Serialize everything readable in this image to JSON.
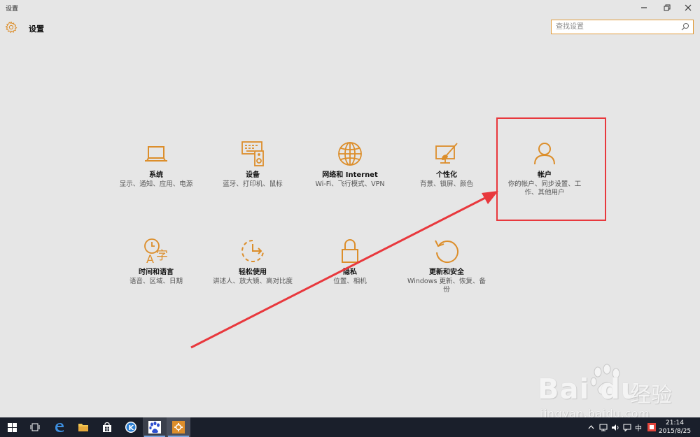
{
  "window": {
    "title": "设置",
    "controls": [
      "minimize-icon",
      "restore-icon",
      "close-icon"
    ]
  },
  "header": {
    "icon": "gear-icon",
    "title": "设置"
  },
  "search": {
    "placeholder": "查找设置",
    "value": "",
    "icon": "search-icon"
  },
  "tiles": [
    {
      "id": "system",
      "icon": "laptop-icon",
      "name": "系统",
      "desc": "显示、通知、应用、电源"
    },
    {
      "id": "devices",
      "icon": "devices-icon",
      "name": "设备",
      "desc": "蓝牙、打印机、鼠标"
    },
    {
      "id": "network",
      "icon": "globe-icon",
      "name": "网络和 Internet",
      "desc": "Wi-Fi、飞行模式、VPN"
    },
    {
      "id": "personalization",
      "icon": "paintbrush-icon",
      "name": "个性化",
      "desc": "背景、锁屏、颜色"
    },
    {
      "id": "accounts",
      "icon": "person-icon",
      "name": "帐户",
      "desc": "你的帐户、同步设置、工作、其他用户"
    },
    {
      "id": "time-language",
      "icon": "time-language-icon",
      "name": "时间和语言",
      "desc": "语音、区域、日期"
    },
    {
      "id": "ease-of-access",
      "icon": "ease-of-access-icon",
      "name": "轻松使用",
      "desc": "讲述人、放大镜、高对比度"
    },
    {
      "id": "privacy",
      "icon": "lock-icon",
      "name": "隐私",
      "desc": "位置、相机"
    },
    {
      "id": "update-security",
      "icon": "refresh-icon",
      "name": "更新和安全",
      "desc": "Windows 更新、恢复、备份"
    }
  ],
  "colors": {
    "accent": "#dc8e2b",
    "highlight": "#e8383d",
    "taskbar": "#1a1f2b",
    "background": "#e6e6e6"
  },
  "watermark": {
    "logo": "Bai du",
    "suffix": "经验",
    "url": "jingyan.baidu.com"
  },
  "taskbar": {
    "items": [
      "windows-start-icon",
      "task-view-icon",
      "edge-icon",
      "file-explorer-icon",
      "store-icon",
      "k-app-icon",
      "baidu-app-icon",
      "settings-app-icon"
    ],
    "tray": {
      "ime": "中",
      "time": "21:14",
      "date": "2015/8/25"
    }
  }
}
